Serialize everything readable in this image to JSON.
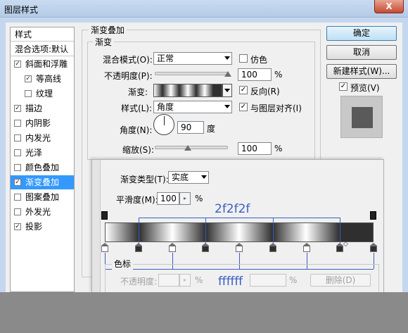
{
  "window": {
    "title": "图层样式",
    "close_glyph": "X"
  },
  "sidebar": {
    "header": "样式",
    "blend_default": "混合选项:默认",
    "items": [
      {
        "label": "斜面和浮雕",
        "checked": true
      },
      {
        "label": "等高线",
        "checked": true
      },
      {
        "label": "纹理",
        "checked": false
      },
      {
        "label": "描边",
        "checked": true
      },
      {
        "label": "内阴影",
        "checked": false
      },
      {
        "label": "内发光",
        "checked": false
      },
      {
        "label": "光泽",
        "checked": false
      },
      {
        "label": "颜色叠加",
        "checked": false
      },
      {
        "label": "渐变叠加",
        "checked": true,
        "selected": true
      },
      {
        "label": "图案叠加",
        "checked": false
      },
      {
        "label": "外发光",
        "checked": false
      },
      {
        "label": "投影",
        "checked": true
      }
    ]
  },
  "overlay": {
    "group_title": "渐变叠加",
    "sub_title": "渐变",
    "blend_mode_label": "混合模式(O):",
    "blend_mode_value": "正常",
    "dither_label": "仿色",
    "opacity_label": "不透明度(P):",
    "opacity_value": "100",
    "opacity_level": 1.0,
    "percent": "%",
    "gradient_label": "渐变:",
    "reverse_label": "反向(R)",
    "reverse_checked": true,
    "style_label": "样式(L):",
    "style_value": "角度",
    "align_label": "与图层对齐(I)",
    "align_checked": true,
    "angle_label": "角度(N):",
    "angle_value": "90",
    "degree_unit": "度",
    "scale_label": "缩放(S):",
    "scale_value": "100",
    "scale_level": 0.45
  },
  "buttons": {
    "ok": "确定",
    "cancel": "取消",
    "new_style": "新建样式(W)...",
    "preview_label": "预览(V)",
    "preview_checked": true
  },
  "editor": {
    "type_label": "渐变类型(T):",
    "type_value": "实底",
    "smooth_label": "平滑度(M):",
    "smooth_value": "100",
    "percent": "%",
    "annotation_dark": "2f2f2f",
    "annotation_light": "ffffff",
    "color_stop_title": "色标",
    "opacity_label": "不透明度:",
    "delete_button": "删除(D)",
    "colors": {
      "dark": "#2f2f2f",
      "light": "#ffffff",
      "annotation": "#3a5fc4"
    },
    "color_stops": [
      "light",
      "dark",
      "light",
      "dark",
      "light",
      "dark",
      "light",
      "dark",
      "dark"
    ]
  }
}
